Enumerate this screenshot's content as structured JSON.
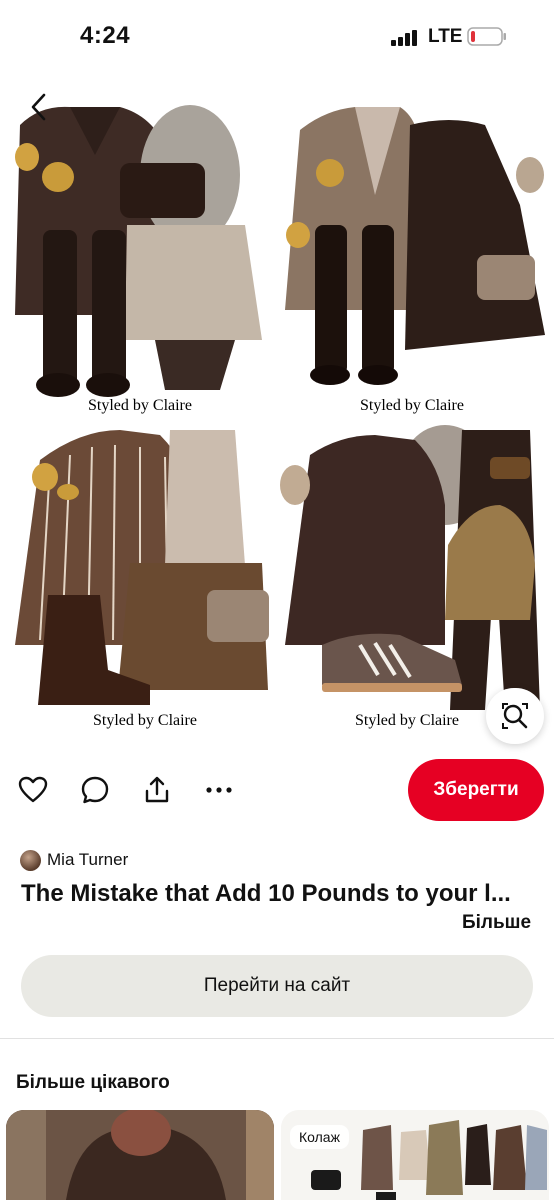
{
  "status_bar": {
    "time": "4:24",
    "network": "LTE"
  },
  "pin": {
    "captions": [
      "Styled by Claire",
      "Styled by Claire",
      "Styled by Claire",
      "Styled by Claire"
    ]
  },
  "actions": {
    "save_label": "Зберегти"
  },
  "author": {
    "name": "Mia Turner"
  },
  "title": "The Mistake that Add 10 Pounds to your l...",
  "more_label": "Більше",
  "visit_site_label": "Перейти на сайт",
  "more_ideas": {
    "heading": "Більше цікавого",
    "collage_label": "Колаж"
  },
  "colors": {
    "save": "#e60023",
    "site_button": "#e9e9e4",
    "battery_low": "#e0323a"
  },
  "icons": [
    "back-arrow-icon",
    "visual-search-icon",
    "heart-icon",
    "comment-icon",
    "share-icon",
    "more-icon"
  ]
}
